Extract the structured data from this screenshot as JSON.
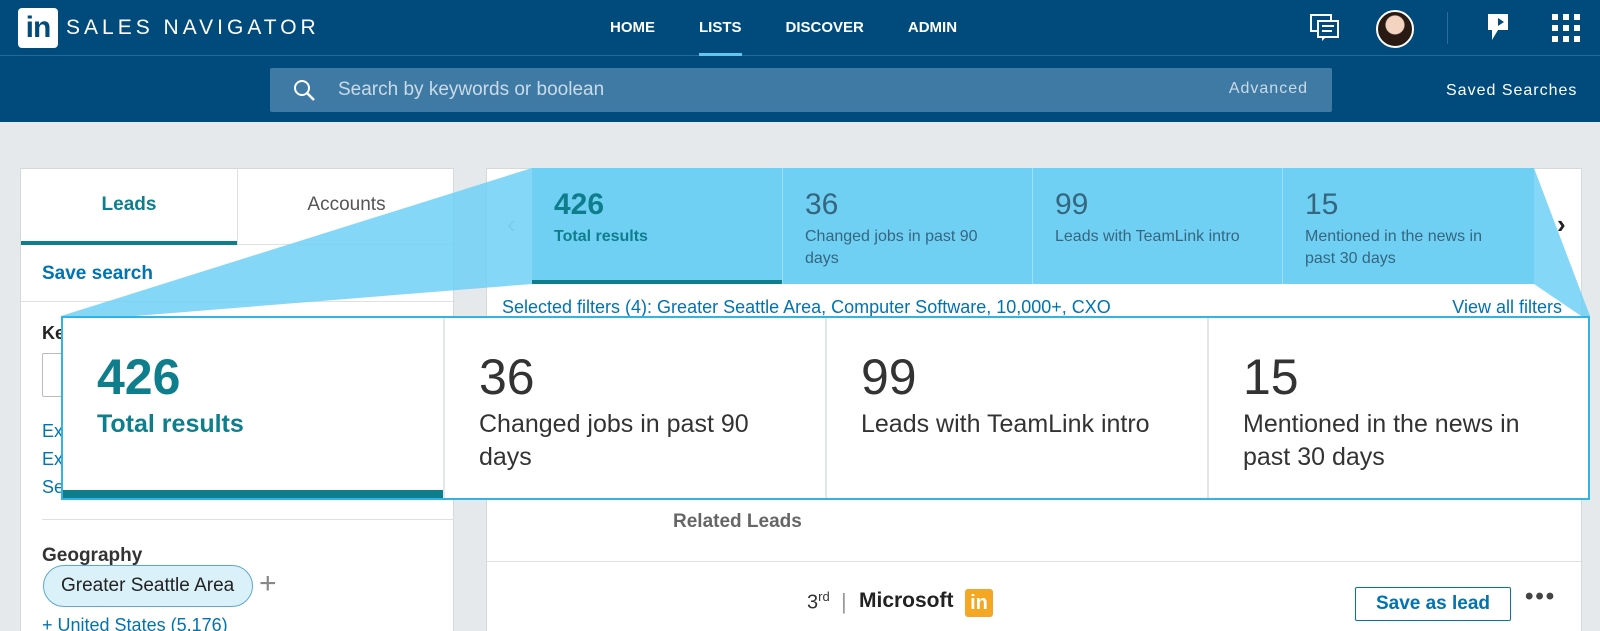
{
  "app": {
    "logo_text": "in",
    "brand": "SALES NAVIGATOR"
  },
  "nav": {
    "items": [
      {
        "label": "HOME",
        "active": false
      },
      {
        "label": "LISTS",
        "active": true
      },
      {
        "label": "DISCOVER",
        "active": false
      },
      {
        "label": "ADMIN",
        "active": false
      }
    ]
  },
  "search": {
    "placeholder": "Search by keywords or boolean",
    "advanced_label": "Advanced",
    "saved_searches_label": "Saved Searches"
  },
  "left_panel": {
    "tabs": [
      {
        "label": "Leads",
        "active": true
      },
      {
        "label": "Accounts",
        "active": false
      }
    ],
    "save_search_label": "Save search",
    "keywords_label": "Ke",
    "links": [
      "Ex",
      "Ex",
      "Se"
    ],
    "geography_label": "Geography",
    "geography_pill": "Greater Seattle Area",
    "geography_more": "+ United States (5,176)"
  },
  "results_strip": {
    "prev_arrow": "‹",
    "next_arrow": "›",
    "cells": [
      {
        "count": "426",
        "label": "Total results",
        "active": true
      },
      {
        "count": "36",
        "label": "Changed jobs in past 90 days",
        "active": false
      },
      {
        "count": "99",
        "label": "Leads with TeamLink intro",
        "active": false
      },
      {
        "count": "15",
        "label": "Mentioned in the news in past 30 days",
        "active": false
      }
    ],
    "selected_filters": "Selected filters (4): Greater Seattle Area, Computer Software, 10,000+, CXO",
    "view_all_filters": "View all filters"
  },
  "related_leads_label": "Related Leads",
  "lead_card": {
    "degree": "3",
    "degree_suffix": "rd",
    "separator": "|",
    "company": "Microsoft",
    "badge": "in",
    "save_label": "Save as lead",
    "more_label": "•••"
  },
  "colors": {
    "nav_bg": "#004b7c",
    "accent_teal": "#0f7e8c",
    "link_blue": "#0073b1",
    "highlight_blue": "#6fd0f4",
    "badge_orange": "#f5a623"
  }
}
